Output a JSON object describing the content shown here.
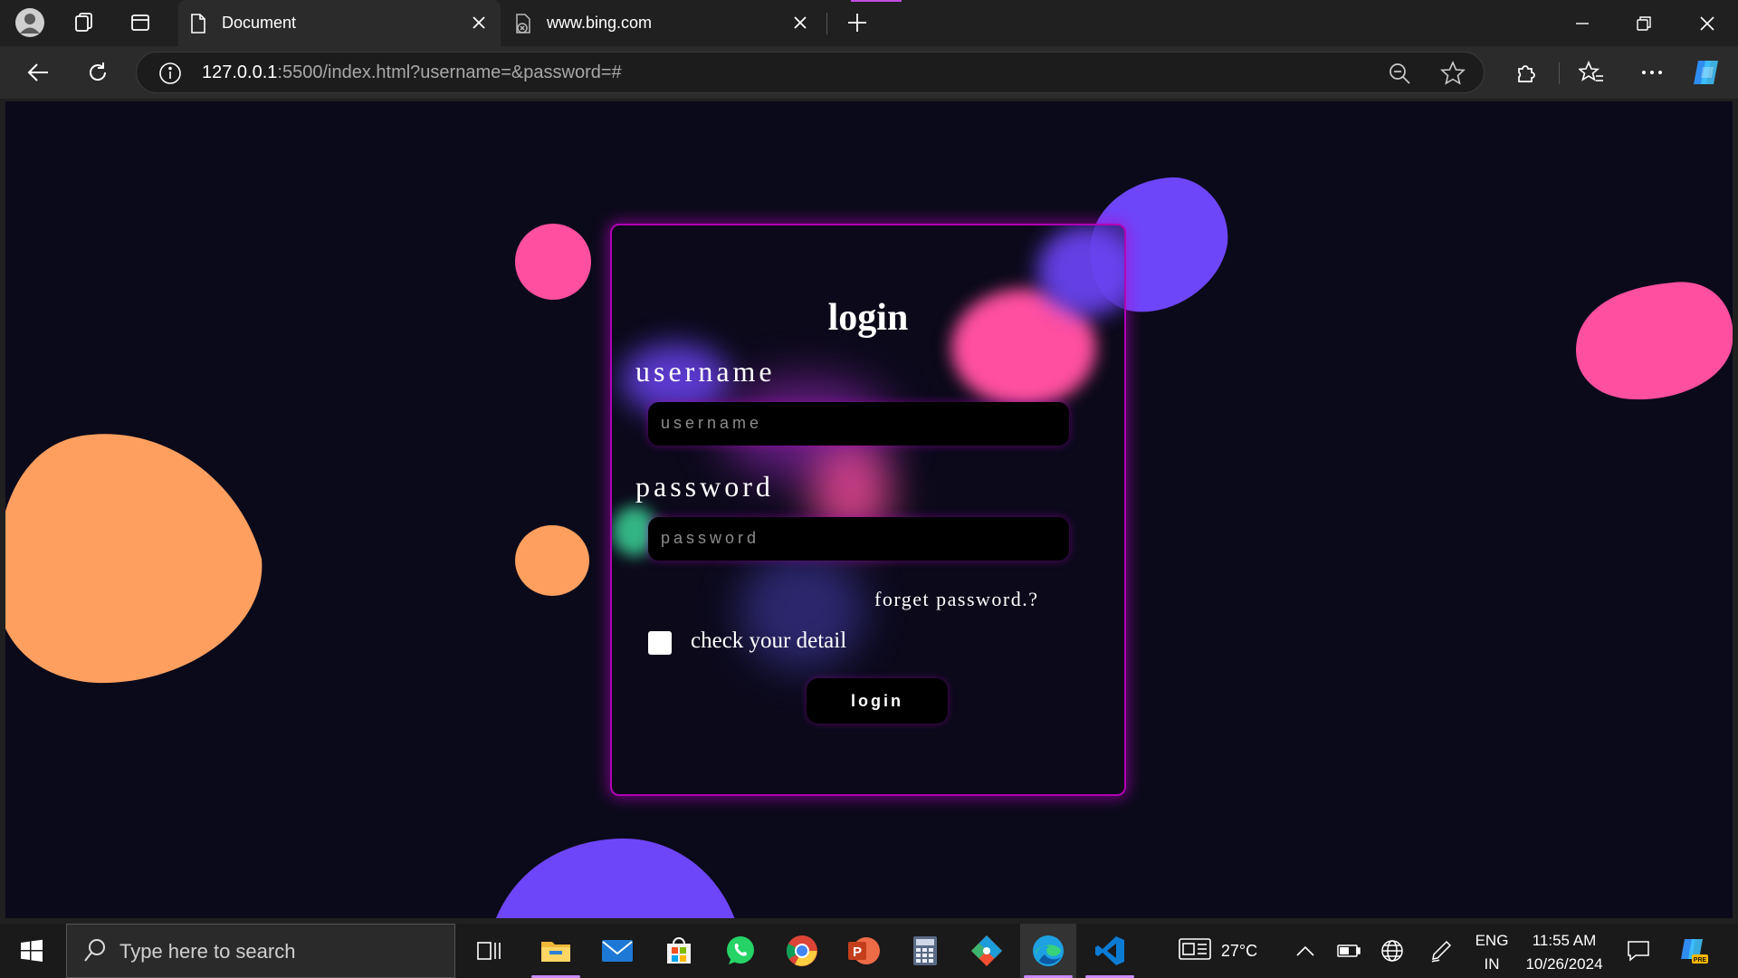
{
  "browser": {
    "tabs": [
      {
        "title": "Document",
        "active": true,
        "icon": "page-icon"
      },
      {
        "title": "www.bing.com",
        "active": false,
        "icon": "bing-error-page-icon"
      }
    ],
    "address": {
      "host": "127.0.0.1",
      "rest": ":5500/index.html?username=&password=#"
    }
  },
  "page": {
    "card_title": "login",
    "username_label": "username",
    "username_placeholder": "username",
    "password_label": "password",
    "password_placeholder": "password",
    "forget_link": "forget password.?",
    "checkbox_label": "check your detail",
    "checkbox_checked": false,
    "login_button": "login",
    "colors": {
      "background": "#0b0a1a",
      "orange": "#ff9f5f",
      "pink": "#ff4fa0",
      "purple": "#6e46fa",
      "border": "#b000b4"
    }
  },
  "taskbar": {
    "search_placeholder": "Type here to search",
    "apps": [
      "task-view",
      "file-explorer",
      "mail",
      "microsoft-store",
      "whatsapp",
      "chrome",
      "powerpoint",
      "calculator",
      "git-app",
      "edge",
      "vscode"
    ],
    "weather": "27°C",
    "language_top": "ENG",
    "language_bottom": "IN",
    "time": "11:55 AM",
    "date": "10/26/2024"
  }
}
